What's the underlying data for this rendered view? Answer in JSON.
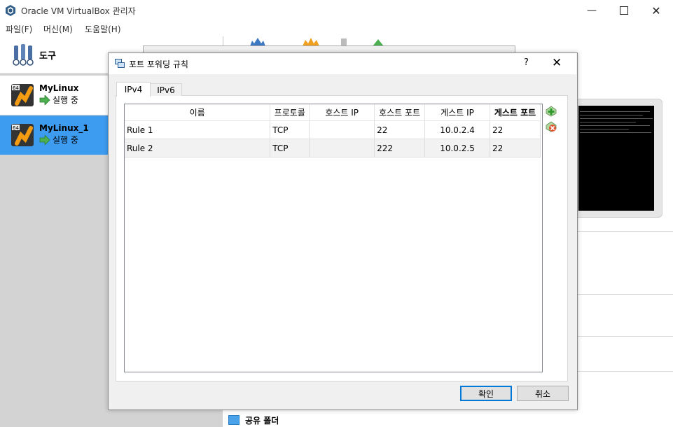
{
  "app": {
    "title": "Oracle VM VirtualBox 관리자"
  },
  "menu": [
    "파일(F)",
    "머신(M)",
    "도움말(H)"
  ],
  "sidebar": {
    "tools_label": "도구",
    "vms": [
      {
        "name": "MyLinux",
        "status": "실행 중",
        "selected": false
      },
      {
        "name": "MyLinux_1",
        "status": "실행 중",
        "selected": true
      }
    ]
  },
  "details": {
    "shared_folders_label": "공유 폴더"
  },
  "dialog": {
    "title": "포트 포워딩 규칙",
    "help": "?",
    "tabs": [
      {
        "label": "IPv4",
        "active": true
      },
      {
        "label": "IPv6",
        "active": false
      }
    ],
    "columns": [
      "이름",
      "프로토콜",
      "호스트 IP",
      "호스트 포트",
      "게스트 IP",
      "게스트 포트"
    ],
    "rows": [
      {
        "name": "Rule 1",
        "protocol": "TCP",
        "host_ip": "",
        "host_port": "22",
        "guest_ip": "10.0.2.4",
        "guest_port": "22"
      },
      {
        "name": "Rule 2",
        "protocol": "TCP",
        "host_ip": "",
        "host_port": "222",
        "guest_ip": "10.0.2.5",
        "guest_port": "22"
      }
    ],
    "ok_label": "확인",
    "cancel_label": "취소"
  },
  "colors": {
    "selection": "#3d9cf0",
    "accent": "#0078d7"
  }
}
